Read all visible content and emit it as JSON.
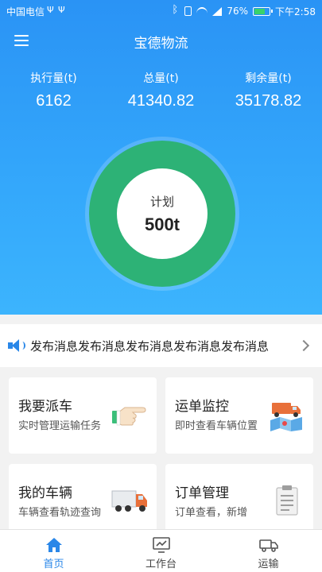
{
  "status_bar": {
    "carrier": "中国电信",
    "battery": "76%",
    "battery_level": 0.76,
    "time": "下午2:58"
  },
  "app": {
    "title": "宝德物流"
  },
  "stats": [
    {
      "label": "执行量(t)",
      "value": "6162"
    },
    {
      "label": "总量(t)",
      "value": "41340.82"
    },
    {
      "label": "剩余量(t)",
      "value": "35178.82"
    }
  ],
  "plan": {
    "label": "计划",
    "value": "500t"
  },
  "notice": {
    "text": "发布消息发布消息发布消息发布消息发布消息"
  },
  "cards": [
    {
      "title": "我要派车",
      "subtitle": "实时管理运输任务",
      "icon": "pointing-hand-icon"
    },
    {
      "title": "运单监控",
      "subtitle": "即时查看车辆位置",
      "icon": "truck-map-icon"
    },
    {
      "title": "我的车辆",
      "subtitle": "车辆查看轨迹查询",
      "icon": "truck-icon"
    },
    {
      "title": "订单管理",
      "subtitle": "订单查看，新增",
      "icon": "clipboard-icon"
    }
  ],
  "tabs": [
    {
      "label": "首页",
      "icon": "home-icon",
      "active": true
    },
    {
      "label": "工作台",
      "icon": "workbench-icon",
      "active": false
    },
    {
      "label": "运输",
      "icon": "truck-icon",
      "active": false
    }
  ],
  "colors": {
    "primary": "#2a87e8",
    "header_gradient_top": "#2a93f5",
    "header_gradient_bottom": "#3cb4fd",
    "ring_green": "#2db276"
  }
}
